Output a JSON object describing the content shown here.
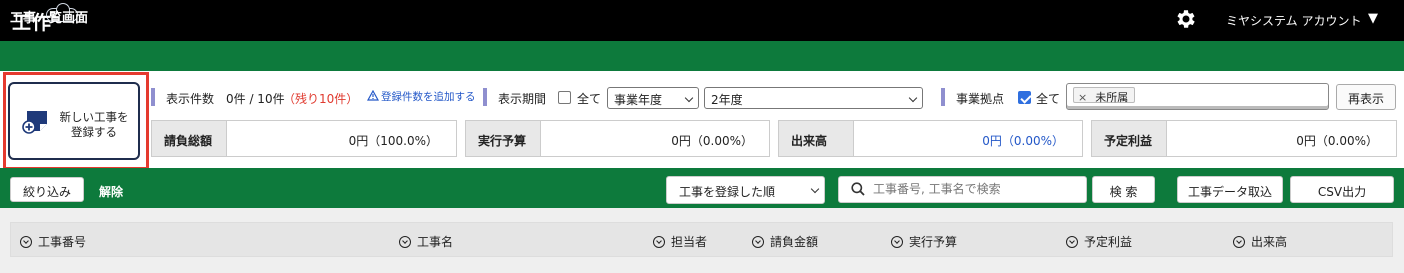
{
  "header": {
    "logo_text": "工作",
    "account": "ミヤシステム アカウント",
    "caret": "▼"
  },
  "page_title": "工事一覧画面",
  "new_project": {
    "line1": "新しい工事を",
    "line2": "登録する"
  },
  "counts": {
    "label": "表示件数",
    "value": "0件 / 10件",
    "remaining": "（残り10件）",
    "add_link": "登録件数を追加する"
  },
  "period": {
    "label": "表示期間",
    "all_label": "全て",
    "all_checked": false,
    "type_selected": "事業年度",
    "year_selected": "2年度"
  },
  "location": {
    "label": "事業拠点",
    "all_label": "全て",
    "all_checked": true,
    "tag": "未所属",
    "tag_remove": "×",
    "redisplay": "再表示"
  },
  "stats": [
    {
      "label": "請負総額",
      "value": "0円（100.0%）",
      "color": "#222222"
    },
    {
      "label": "実行予算",
      "value": "0円（0.00%）",
      "color": "#222222"
    },
    {
      "label": "出来高",
      "value": "0円（0.00%）",
      "color": "#2458c8"
    },
    {
      "label": "予定利益",
      "value": "0円（0.00%）",
      "color": "#222222"
    }
  ],
  "filter": {
    "narrow": "絞り込み",
    "clear": "解除",
    "sort_selected": "工事を登録した順",
    "search_placeholder": "工事番号, 工事名で検索",
    "search_button": "検 索",
    "import": "工事データ取込",
    "csv": "CSV出力"
  },
  "columns": [
    "工事番号",
    "工事名",
    "担当者",
    "請負金額",
    "実行予算",
    "予定利益",
    "出来高"
  ],
  "colors": {
    "brand_green": "#0d7a3c",
    "highlight_red": "#e53a2f",
    "accent_bar": "#8f8fcf"
  },
  "icons": {
    "settings": "gear-icon",
    "new": "add-document-icon",
    "search": "search-icon",
    "sort": "sort-circle-icon",
    "warning": "warning-icon"
  }
}
